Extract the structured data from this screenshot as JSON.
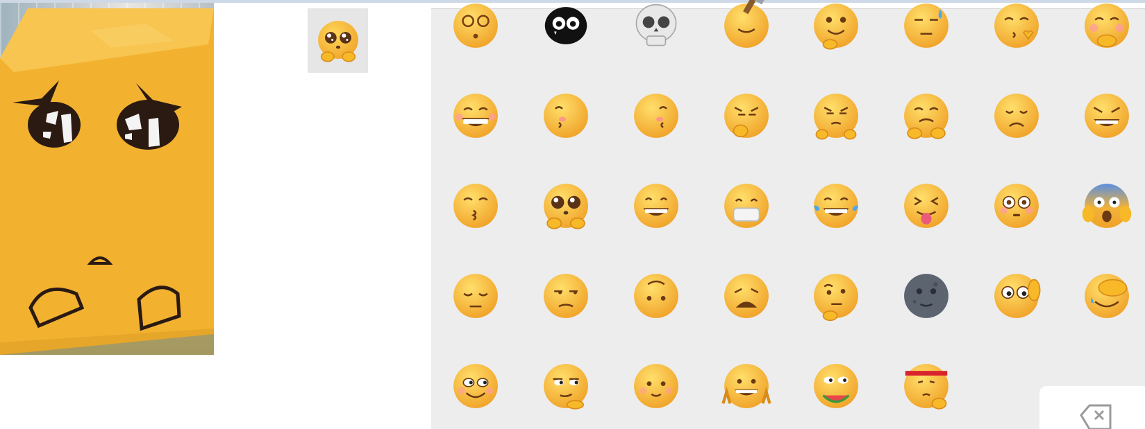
{
  "photo": {
    "subject": "box-face-photo"
  },
  "preview": {
    "emoji": "pleading-eyes-hands"
  },
  "keyboard": {
    "rows": [
      [
        "dizzy-swirl-eyes",
        "black-sheep-tear",
        "skull",
        "hammer-knock",
        "chin-smirk",
        "sweat-drop-deadpan",
        "kiss-heart",
        "shy-giggle-hands"
      ],
      [
        "big-grin-blush",
        "side-glance-left",
        "side-glance-right",
        "facepalm-angry",
        "angry-hands-up",
        "pleading-hands",
        "sad-droopy",
        "evil-grin"
      ],
      [
        "whistle-kiss",
        "pleading-eyes-hands",
        "grin",
        "face-with-mask",
        "tears-of-joy",
        "tongue-squint",
        "flushed",
        "screaming-in-fear"
      ],
      [
        "pensive",
        "unamused",
        "upside-hmm",
        "weary",
        "thinking",
        "new-moon-face",
        "peek-wave",
        "face-palm-cry"
      ],
      [
        "smirk-wink",
        "side-eye-point",
        "content-smile",
        "peace-grin",
        "watermelon-eat",
        "headband-fist"
      ]
    ],
    "delete_key": "backspace-icon"
  },
  "colors": {
    "emoji_yellow": "#f7b928",
    "emoji_shadow": "#e0921a",
    "panel_bg": "#ededed",
    "box_yellow": "#f2b230"
  }
}
